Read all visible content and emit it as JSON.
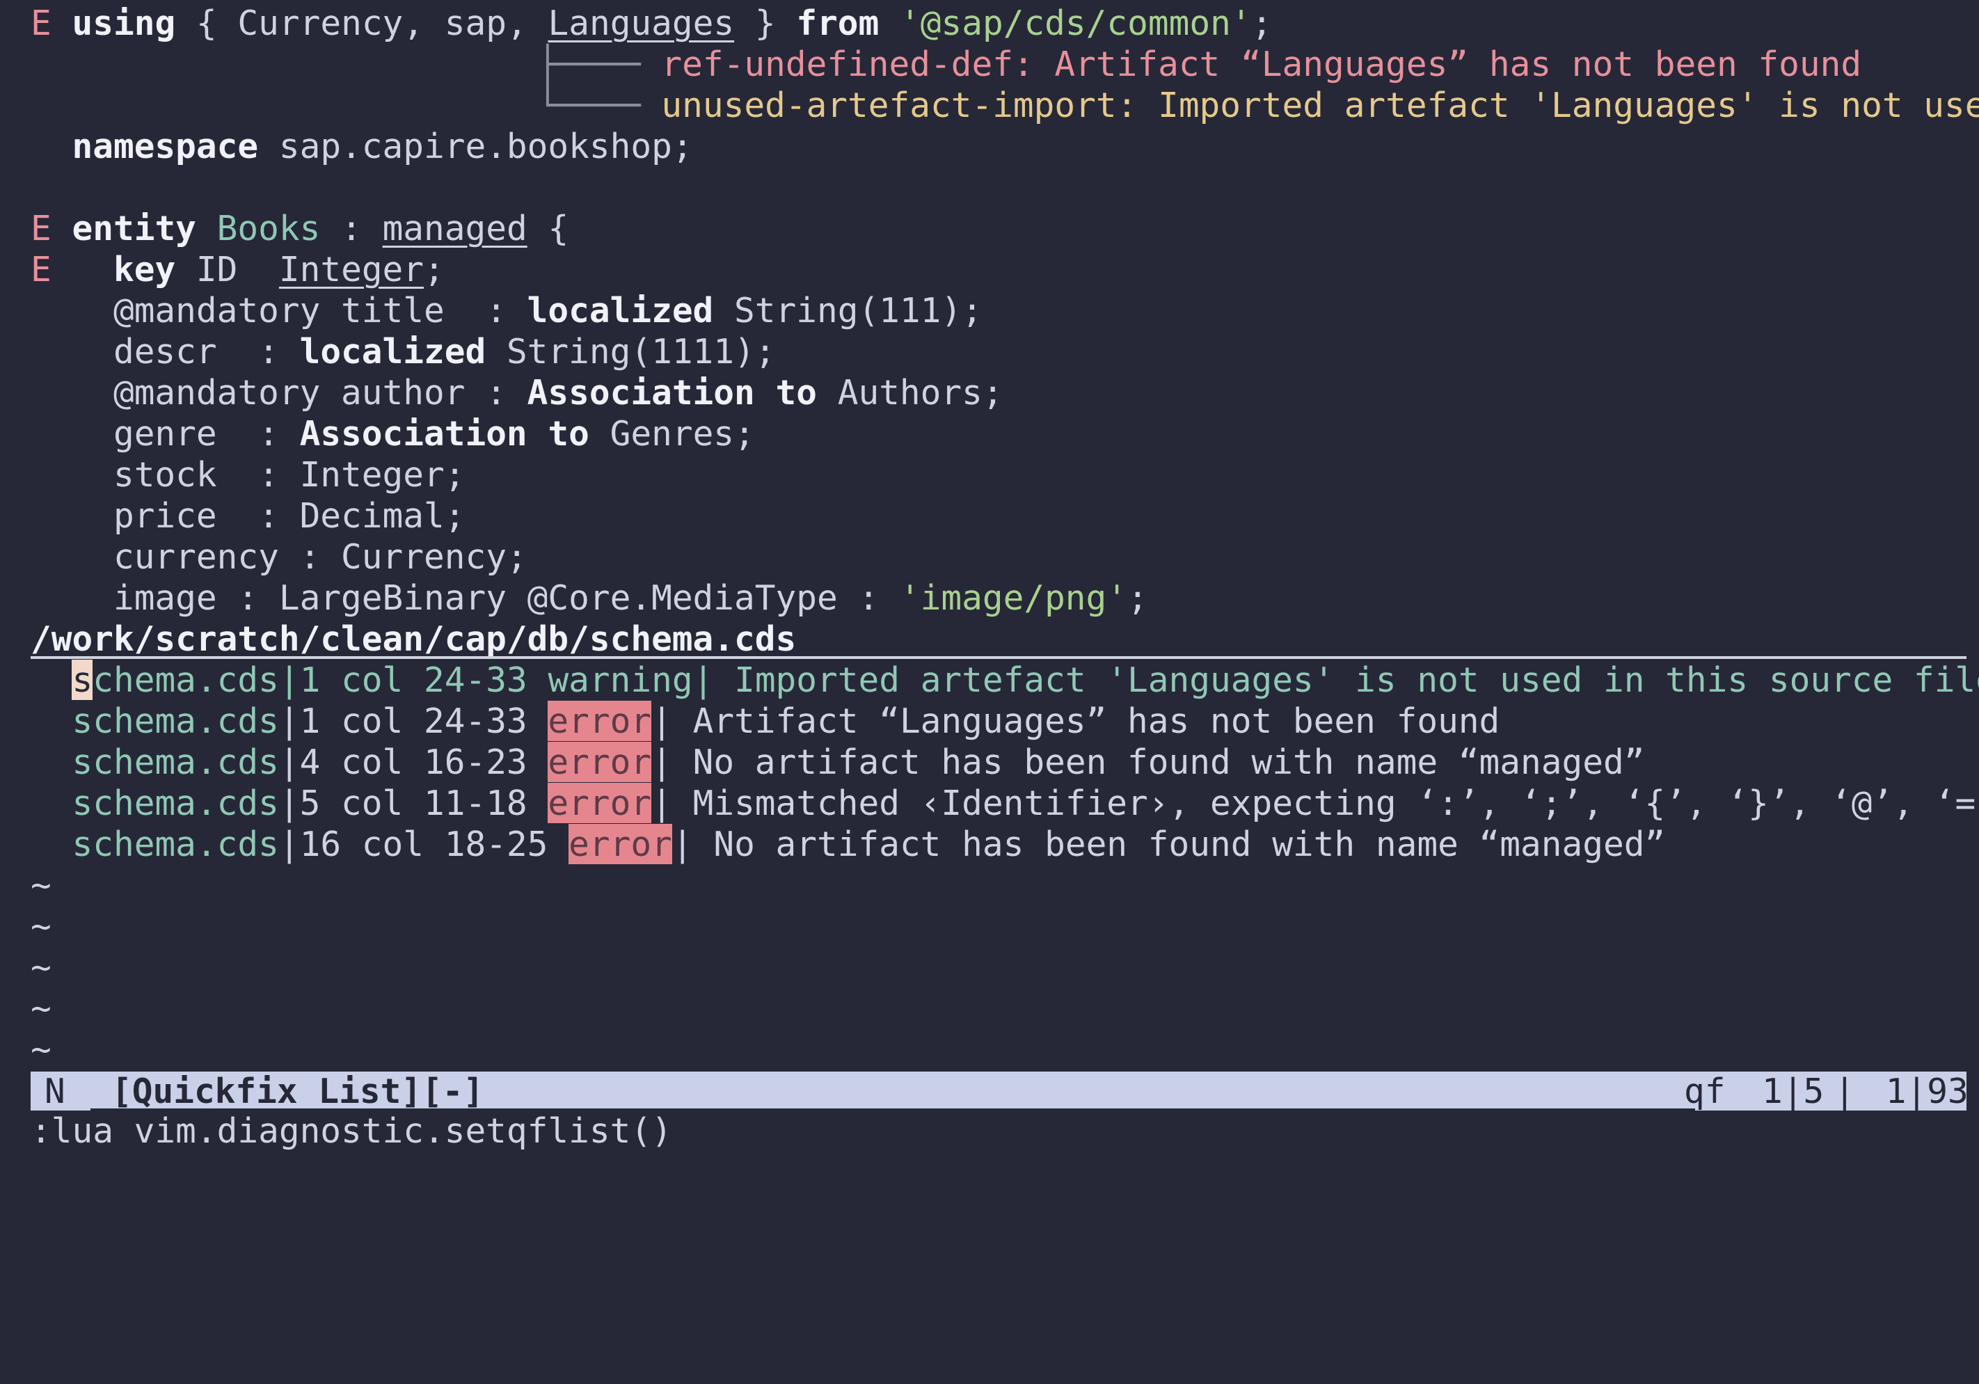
{
  "editor": {
    "line1": {
      "sign": "E",
      "using": "using",
      "brace_open": " { ",
      "currency": "Currency",
      "comma1": ", ",
      "sap": "sap",
      "comma2": ", ",
      "languages": "Languages",
      "brace_close": " } ",
      "from": "from",
      "space": " ",
      "path": "'@sap/cds/common'",
      "semi": ";"
    },
    "virt1": {
      "tree": "├──── ",
      "text": "ref-undefined-def: Artifact “Languages” has not been found"
    },
    "virt2": {
      "tree": "└──── ",
      "text": "unused-artefact-import: Imported artefact 'Languages' is not used"
    },
    "line2": {
      "kw": "namespace",
      "rest": " sap.capire.bookshop;"
    },
    "line4": {
      "sign": "E",
      "kw": "entity",
      "name": " Books",
      "colon": " : ",
      "managed": "managed",
      "brace": " {"
    },
    "line5": {
      "sign": "E",
      "kw": "key",
      "id": " ID  ",
      "integer": "Integer",
      "semi": ";"
    },
    "line6": {
      "a": "@mandatory title  : ",
      "kw": "localized",
      "b": " String(111);"
    },
    "line7": {
      "a": "descr  : ",
      "kw": "localized",
      "b": " String(1111);"
    },
    "line8": {
      "a": "@mandatory author : ",
      "kw": "Association to",
      "b": " Authors;"
    },
    "line9": {
      "a": "genre  : ",
      "kw": "Association to",
      "b": " Genres;"
    },
    "line10": {
      "text": "stock  : Integer;"
    },
    "line11": {
      "text": "price  : Decimal;"
    },
    "line12": {
      "text": "currency : Currency;"
    },
    "line13": {
      "a": "image : LargeBinary @Core.MediaType : ",
      "str": "'image/png'",
      "b": ";"
    }
  },
  "filename": "/work/scratch/clean/cap/db/schema.cds",
  "quickfix": {
    "items": [
      {
        "cursor": "s",
        "file": "chema.cds",
        "loc": "|1 col 24-33 ",
        "type": "warning",
        "sep": "|",
        "msg": " Imported artefact 'Languages' is not used in this source file"
      },
      {
        "file": "schema.cds",
        "loc": "|1 col 24-33 ",
        "type": "error",
        "sep": "|",
        "msg": " Artifact “Languages” has not been found"
      },
      {
        "file": "schema.cds",
        "loc": "|4 col 16-23 ",
        "type": "error",
        "sep": "|",
        "msg": " No artifact has been found with name “managed”"
      },
      {
        "file": "schema.cds",
        "loc": "|5 col 11-18 ",
        "type": "error",
        "sep": "|",
        "msg": " Mismatched ‹Identifier›, expecting ‘:’, ‘;’, ‘{’, ‘}’, ‘@’, ‘=’"
      },
      {
        "file": "schema.cds",
        "loc": "|16 col 18-25 ",
        "type": "error",
        "sep": "|",
        "msg": " No artifact has been found with name “managed”"
      }
    ],
    "tilde": "~"
  },
  "statusline": {
    "mode": "N",
    "name": "[Quickfix List][-]",
    "filetype": "qf",
    "position": "1|5",
    "separator": "|",
    "cursor": " 1|93"
  },
  "cmdline": ":lua vim.diagnostic.setqflist()"
}
